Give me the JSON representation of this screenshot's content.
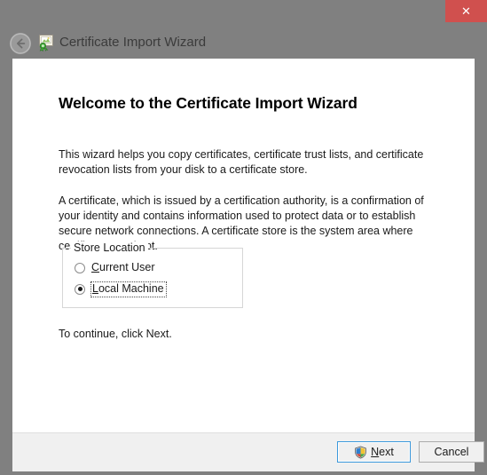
{
  "window": {
    "title": "Certificate Import Wizard",
    "title_icon": "certificate-icon",
    "back_icon": "back-arrow-icon",
    "close_icon": "close-icon",
    "close_label": "✕",
    "titlebar_color": "#808080",
    "close_button_color": "#d0504e"
  },
  "page": {
    "heading": "Welcome to the Certificate Import Wizard",
    "paragraph_1": "This wizard helps you copy certificates, certificate trust lists, and certificate revocation lists from your disk to a certificate store.",
    "paragraph_2": "A certificate, which is issued by a certification authority, is a confirmation of your identity and contains information used to protect data or to establish secure network connections. A certificate store is the system area where certificates are kept.",
    "paragraph_3": "To continue, click Next."
  },
  "store_location": {
    "legend": "Store Location",
    "options": [
      {
        "label": "Current User",
        "accel_prefix": "",
        "accel": "C",
        "accel_suffix": "urrent User",
        "selected": false,
        "focused": false
      },
      {
        "label": "Local Machine",
        "accel_prefix": "",
        "accel": "L",
        "accel_suffix": "ocal Machine",
        "selected": true,
        "focused": true
      }
    ],
    "selected_value": "Local Machine"
  },
  "footer": {
    "next": {
      "label": "Next",
      "accel_prefix": "N",
      "accel_suffix": "ext",
      "icon": "uac-shield-icon",
      "is_default": true,
      "accent_color": "#3c99dc"
    },
    "cancel": {
      "label": "Cancel"
    }
  }
}
